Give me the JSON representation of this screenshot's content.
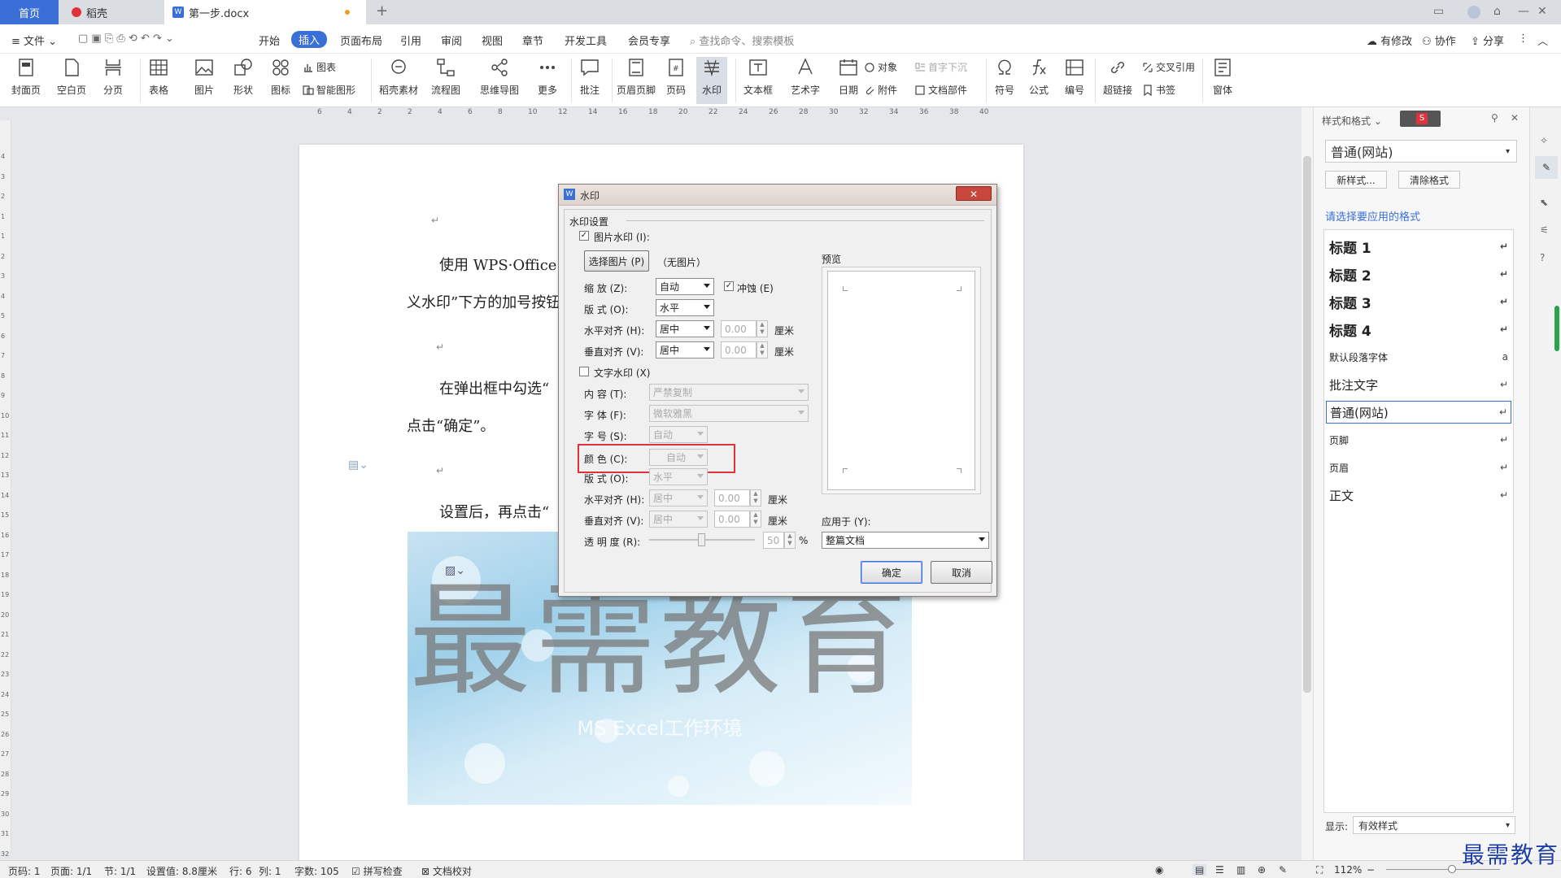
{
  "tabs": {
    "home": "首页",
    "daoke": "稻壳",
    "doc": "第一步.docx",
    "add": "+"
  },
  "menu": {
    "file": "文件",
    "items": [
      "开始",
      "插入",
      "页面布局",
      "引用",
      "审阅",
      "视图",
      "章节",
      "开发工具",
      "会员专享"
    ],
    "search": "查找命令、搜索模板",
    "right": [
      "有修改",
      "协作",
      "分享"
    ]
  },
  "ribbon": {
    "big": [
      "封面页",
      "空白页",
      "分页",
      "表格",
      "图片",
      "形状",
      "图标",
      "稻壳素材",
      "流程图",
      "思维导图",
      "更多",
      "批注",
      "页眉页脚",
      "页码",
      "水印",
      "文本框",
      "艺术字",
      "日期",
      "符号",
      "公式",
      "编号",
      "超链接",
      "窗体"
    ],
    "small": [
      "图表",
      "智能图形",
      "对象",
      "首字下沉",
      "附件",
      "文档部件",
      "交叉引用",
      "书签"
    ]
  },
  "ruler": {
    "marks": [
      "6",
      "4",
      "2",
      "2",
      "4",
      "6",
      "8",
      "10",
      "12",
      "14",
      "16",
      "18",
      "20",
      "22",
      "24",
      "26",
      "28",
      "30",
      "32",
      "34",
      "36",
      "38",
      "40"
    ]
  },
  "vruler": {
    "marks": [
      "4",
      "3",
      "2",
      "1",
      "1",
      "2",
      "3",
      "4",
      "5",
      "6",
      "7",
      "8",
      "9",
      "10",
      "11",
      "12",
      "13",
      "14",
      "15",
      "16",
      "17",
      "18",
      "19",
      "20",
      "21",
      "22",
      "23",
      "24",
      "25",
      "26",
      "27",
      "28",
      "29",
      "30",
      "31",
      "32"
    ]
  },
  "page": {
    "para1a": "使用 WPS·Office 打",
    "para1b": "义水印”下方的加号按钮",
    "para2a": "在弹出框中勾选“",
    "para2b": "点击“确定”。",
    "para3": "设置后，再点击“",
    "return": "↵",
    "watermark_text": "最需教育",
    "watermark_sub": "MS Excel工作环境"
  },
  "dialog": {
    "title": "水印",
    "group": "水印设置",
    "pic_wm": "图片水印 (I):",
    "pic_btn": "选择图片 (P)",
    "no_pic": "（无图片）",
    "scale_label": "缩    放 (Z):",
    "scale_val": "自动",
    "washout": "冲蚀 (E)",
    "layout_label": "版    式 (O):",
    "layout_val": "水平",
    "halign_label": "水平对齐 (H):",
    "halign_val": "居中",
    "valign_label": "垂直对齐 (V):",
    "valign_val": "居中",
    "offset": "0.00",
    "cm": "厘米",
    "text_wm": "文字水印 (X)",
    "content_label": "内    容 (T):",
    "content_val": "严禁复制",
    "font_label": "字    体 (F):",
    "font_val": "微软雅黑",
    "size_label": "字    号 (S):",
    "size_val": "自动",
    "color_label": "颜    色 (C):",
    "color_val": "自动",
    "tlayout_label": "版    式 (O):",
    "tlayout_val": "水平",
    "thalign_label": "水平对齐 (H):",
    "tvalign_label": "垂直对齐 (V):",
    "trans_label": "透 明 度 (R):",
    "trans_val": "50",
    "percent": "%",
    "preview": "预览",
    "apply_label": "应用于 (Y):",
    "apply_val": "整篇文档",
    "ok": "确定",
    "cancel": "取消"
  },
  "panel": {
    "title": "样式和格式",
    "current": "普通(网站)",
    "new_style": "新样式...",
    "clear": "清除格式",
    "choose": "请选择要应用的格式",
    "styles": [
      "标题 1",
      "标题 2",
      "标题 3",
      "标题 4",
      "默认段落字体",
      "批注文字",
      "普通(网站)",
      "页脚",
      "页眉",
      "正文"
    ],
    "show_label": "显示:",
    "show_val": "有效样式"
  },
  "status": {
    "page": "页码: 1",
    "pages": "页面: 1/1",
    "section": "节: 1/1",
    "setting": "设置值: 8.8厘米",
    "row": "行: 6",
    "col": "列: 1",
    "words": "字数: 105",
    "spell": "拼写检查",
    "check": "文档校对",
    "zoom": "112%"
  },
  "logo": "最需教育",
  "colors": {
    "accent": "#3b6fd8",
    "highlight": "#e0323a"
  }
}
